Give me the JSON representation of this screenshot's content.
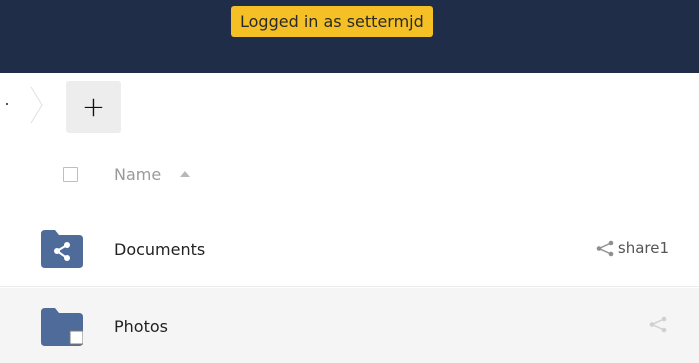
{
  "header": {
    "login_status": "Logged in as settermjd"
  },
  "toolbar": {
    "add_label": "+"
  },
  "file_list": {
    "columns": {
      "name": "Name"
    },
    "rows": [
      {
        "name": "Documents",
        "share_label": "share1",
        "icon": "shared-folder-icon"
      },
      {
        "name": "Photos",
        "share_label": "",
        "icon": "folder-icon"
      }
    ]
  },
  "colors": {
    "topbar": "#1f2d49",
    "badge": "#f4c026",
    "folder": "#4f6b9a"
  }
}
